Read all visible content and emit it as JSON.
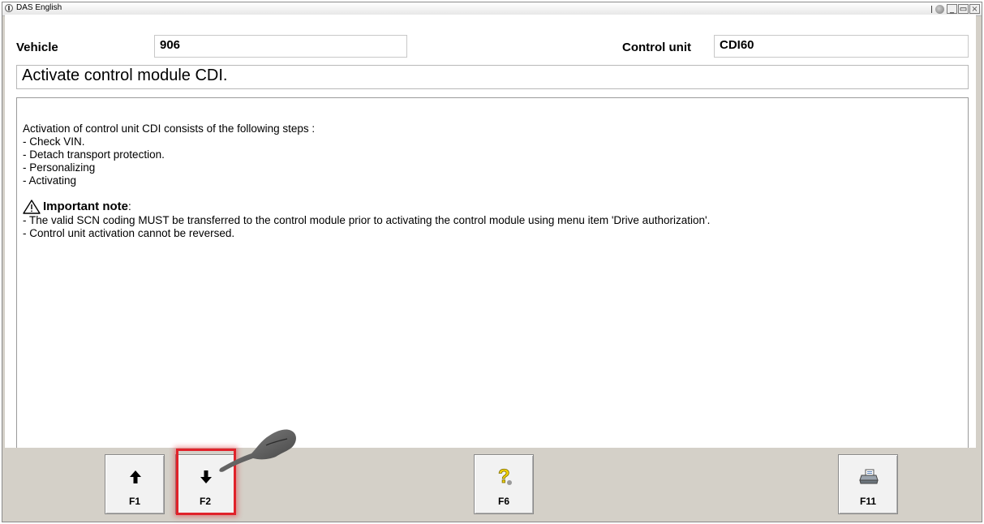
{
  "titlebar": {
    "title": "DAS English",
    "controls": {
      "minimize": "_",
      "restore": "▭",
      "close": "×"
    }
  },
  "vehicle": {
    "label": "Vehicle",
    "value": "906"
  },
  "control_unit": {
    "label": "Control unit",
    "value": "CDI60"
  },
  "header": "Activate control module CDI.",
  "content": {
    "intro": "Activation of control unit CDI consists of the following steps :",
    "steps": [
      "- Check VIN.",
      "- Detach transport protection.",
      "- Personalizing",
      "- Activating"
    ],
    "note_title": "Important note",
    "note_colon": " :",
    "note_lines": [
      "- The valid SCN coding MUST be transferred to the control module prior to activating the control module using menu item 'Drive authorization'.",
      "- Control unit activation cannot be reversed."
    ]
  },
  "buttons": [
    {
      "key": "F1",
      "icon": "arrow-up-icon"
    },
    {
      "key": "F2",
      "icon": "arrow-down-icon"
    },
    {
      "key": "F6",
      "icon": "help-icon"
    },
    {
      "key": "F11",
      "icon": "printer-icon"
    }
  ],
  "colors": {
    "highlight": "#e0222a",
    "help_yellow": "#f5d400"
  }
}
